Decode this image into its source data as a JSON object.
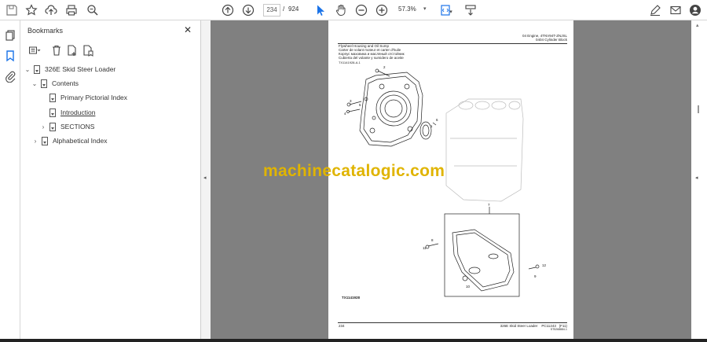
{
  "toolbar": {
    "current_page": "234",
    "page_separator": "/",
    "total_pages": "924",
    "zoom": "57.3%"
  },
  "bookmarks_panel": {
    "title": "Bookmarks",
    "items": [
      {
        "label": "326E Skid Steer Loader",
        "expanded": true,
        "level": 0
      },
      {
        "label": "Contents",
        "expanded": true,
        "level": 1
      },
      {
        "label": "Primary Pictorial Index",
        "level": 2
      },
      {
        "label": "Introduction",
        "level": 2
      },
      {
        "label": "SECTIONS",
        "expanded": false,
        "level": 2
      },
      {
        "label": "Alphabetical Index",
        "expanded": false,
        "level": 1
      }
    ]
  },
  "document_page": {
    "header_right_1": "04 Engine, 4TNV94T-ZNJSL",
    "header_right_2": "0404 Cylinder Block",
    "header_left_lines": [
      "Flywheel Housing and Oil Sump",
      "Carter de volant moteur et carter d'huile",
      "Корпус маховика и масляный отстойник",
      "Cubierta del volante y sumidero de aceite"
    ],
    "ref_top": "TX1141928-A.1",
    "figure_id": "TX1141928",
    "callouts": [
      "1",
      "2",
      "3",
      "4",
      "5",
      "6",
      "7",
      "8",
      "9",
      "10",
      "11",
      "12"
    ],
    "footer_left": "234",
    "footer_right": "326E Skid Steer Loader    PC11243   (F11)",
    "footer_code": "ST5268884-1"
  },
  "watermark": "machinecatalogic.com",
  "icons": [
    "save-icon",
    "star-icon",
    "upload-icon",
    "print-icon",
    "zoom-search-icon",
    "page-up-icon",
    "page-down-icon",
    "select-arrow-icon",
    "hand-icon",
    "zoom-out-icon",
    "zoom-in-icon",
    "fit-page-icon",
    "scroll-mode-icon",
    "sign-icon",
    "mail-icon",
    "account-icon"
  ]
}
